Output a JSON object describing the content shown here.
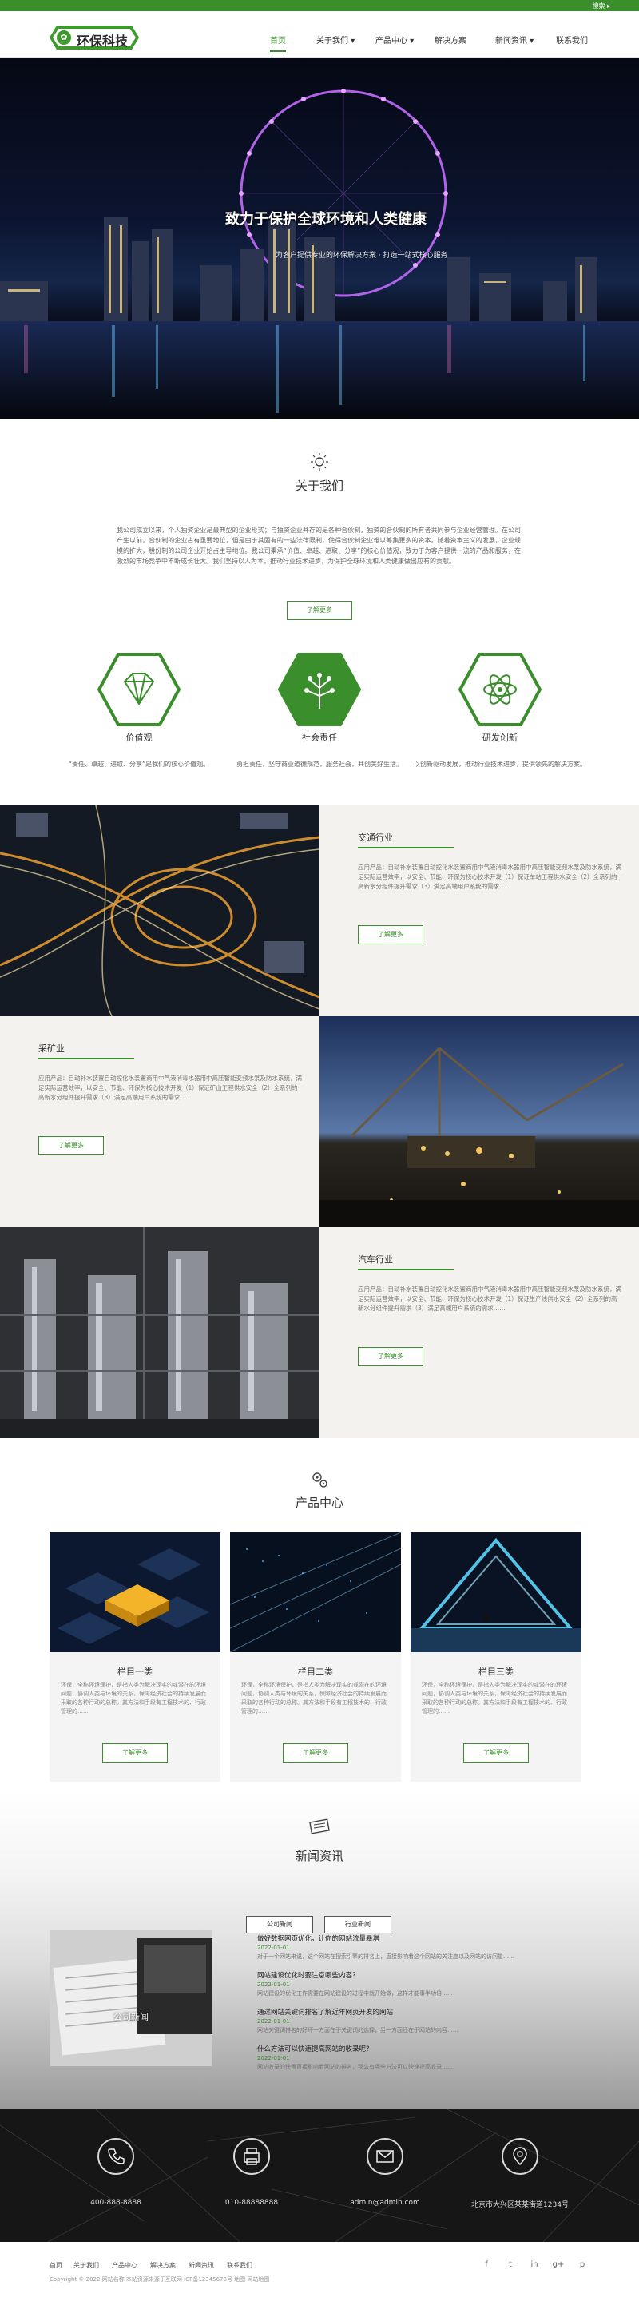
{
  "topbar": {
    "lang_label": "搜索 ▸"
  },
  "brand": {
    "name": "环保科技",
    "accent": "#3a8f2c"
  },
  "nav": {
    "items": [
      {
        "label": "首页"
      },
      {
        "label": "关于我们 ▾"
      },
      {
        "label": "产品中心 ▾"
      },
      {
        "label": "解决方案"
      },
      {
        "label": "新闻资讯 ▾"
      },
      {
        "label": "联系我们"
      }
    ]
  },
  "hero": {
    "title": "致力于保护全球环境和人类健康",
    "subtitle": "为客户提供专业的环保解决方案 · 打造一站式核心服务"
  },
  "about": {
    "icon": "bulb-icon",
    "title": "关于我们",
    "text": "我公司成立以来，个人独资企业是最典型的企业形式；与独资企业并存的是各种合伙制，独资的合伙制的所有者共同参与企业经营管理。在公司产生以前，合伙制的企业占有重要地位，但是由于其固有的一些法律限制，使得合伙制企业难以筹集更多的资本。随着资本主义的发展，企业规模的扩大，股份制的公司企业开始占主导地位。我公司秉承“价值、卓越、进取、分享”的核心价值观，致力于为客户提供一流的产品和服务，在激烈的市场竞争中不断成长壮大。我们坚持以人为本，推动行业技术进步，为保护全球环境和人类健康做出应有的贡献。",
    "more_label": "了解更多",
    "values": [
      {
        "icon": "diamond-icon",
        "title": "价值观",
        "text": "“责任、卓越、进取、分享”是我们的核心价值观。"
      },
      {
        "icon": "tree-icon",
        "title": "社会责任",
        "text": "勇担责任，坚守商业道德规范，服务社会，共创美好生活。"
      },
      {
        "icon": "atom-icon",
        "title": "研发创新",
        "text": "以创新驱动发展，推动行业技术进步，提供领先的解决方案。"
      }
    ]
  },
  "features": [
    {
      "title": "交通行业",
      "text": "应用产品：自动补水装置自动控化水装置商用中气液消毒水器用中高压智能变频水泵及防水系统，满足实际运营效率，以安全、节能、环保为核心技术开发（1）保证车站工程供水安全（2）全系列的高新水分组件提升需求（3）满足高端用户系统的需求……",
      "more_label": "了解更多"
    },
    {
      "title": "采矿业",
      "text": "应用产品：自动补水装置自动控化水装置商用中气液消毒水器用中高压智能变频水泵及防水系统，满足实际运营效率，以安全、节能、环保为核心技术开发（1）保证矿山工程供水安全（2）全系列的高新水分组件提升需求（3）满足高端用户系统的需求……",
      "more_label": "了解更多"
    },
    {
      "title": "汽车行业",
      "text": "应用产品：自动补水装置自动控化水装置商用中气液消毒水器用中高压智能变频水泵及防水系统，满足实际运营效率，以安全、节能、环保为核心技术开发（1）保证生产线供水安全（2）全系列的高新水分组件提升需求（3）满足高端用户系统的需求……",
      "more_label": "了解更多"
    }
  ],
  "products": {
    "icon": "gears-icon",
    "title": "产品中心",
    "items": [
      {
        "name": "栏目一类",
        "text": "环保，全称环境保护，是指人类为解决现实的或潜在的环境问题，协调人类与环境的关系，保障经济社会的持续发展而采取的各种行动的总称。其方法和手段有工程技术的、行政管理的……",
        "more_label": "了解更多"
      },
      {
        "name": "栏目二类",
        "text": "环保，全称环境保护，是指人类为解决现实的或潜在的环境问题，协调人类与环境的关系，保障经济社会的持续发展而采取的各种行动的总称。其方法和手段有工程技术的、行政管理的……",
        "more_label": "了解更多"
      },
      {
        "name": "栏目三类",
        "text": "环保，全称环境保护，是指人类为解决现实的或潜在的环境问题，协调人类与环境的关系，保障经济社会的持续发展而采取的各种行动的总称。其方法和手段有工程技术的、行政管理的……",
        "more_label": "了解更多"
      }
    ]
  },
  "news": {
    "icon": "newspaper-icon",
    "title": "新闻资讯",
    "tabs": [
      {
        "label": "公司新闻"
      },
      {
        "label": "行业新闻"
      }
    ],
    "image_caption": "公司新闻",
    "items": [
      {
        "title": "做好数据网页优化，让你的网站流量暴增",
        "date": "2022-01-01",
        "summary": "对于一个网站来说，这个网站在搜索引擎的排名上，直接影响着这个网站的关注度以及网站的访问量……"
      },
      {
        "title": "网站建设优化时要注意哪些内容？",
        "date": "2022-01-01",
        "summary": "网站建设的优化工作需要在网站建设的过程中就开始做，这样才能事半功倍……"
      },
      {
        "title": "通过网站关键词排名了解近年网页开发的网站",
        "date": "2022-01-01",
        "summary": "网站关键词排名的好坏一方面在于关键词的选择，另一方面还在于网站的内容……"
      },
      {
        "title": "什么方法可以快速提高网站的收录呢?",
        "date": "2022-01-01",
        "summary": "网站收录的快慢直接影响着网站的排名，那么有哪些方法可以快速提高收录……"
      }
    ]
  },
  "contact": {
    "items": [
      {
        "icon": "phone-icon",
        "label": "400-888-8888"
      },
      {
        "icon": "fax-icon",
        "label": "010-88888888"
      },
      {
        "icon": "mail-icon",
        "label": "admin@admin.com"
      },
      {
        "icon": "location-icon",
        "label": "北京市大兴区某某街道1234号"
      }
    ]
  },
  "footer": {
    "links": [
      {
        "label": "首页"
      },
      {
        "label": "关于我们"
      },
      {
        "label": "产品中心"
      },
      {
        "label": "解决方案"
      },
      {
        "label": "新闻资讯"
      },
      {
        "label": "联系我们"
      }
    ],
    "copyright": "Copyright © 2022 网站名称 本站资源来源于互联网 ICP备12345678号 地图 网站地图",
    "social": [
      {
        "icon": "facebook-icon",
        "label": "f"
      },
      {
        "icon": "twitter-icon",
        "label": "t"
      },
      {
        "icon": "linkedin-icon",
        "label": "in"
      },
      {
        "icon": "googleplus-icon",
        "label": "g+"
      },
      {
        "icon": "pinterest-icon",
        "label": "p"
      }
    ]
  }
}
